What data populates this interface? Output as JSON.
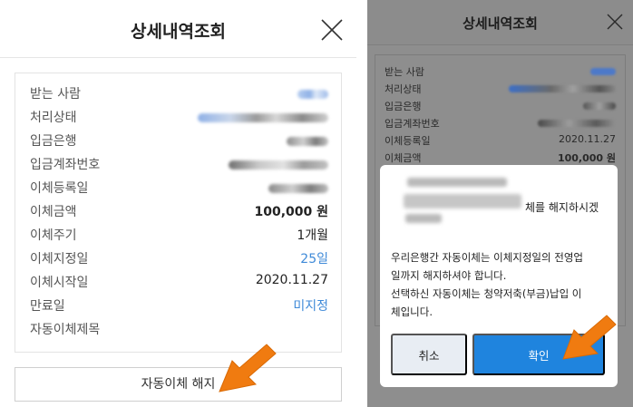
{
  "left": {
    "title": "상세내역조회",
    "rows": [
      {
        "label": "받는 사람",
        "value": ""
      },
      {
        "label": "처리상태",
        "value": ""
      },
      {
        "label": "입금은행",
        "value": ""
      },
      {
        "label": "입금계좌번호",
        "value": ""
      },
      {
        "label": "이체등록일",
        "value": ""
      },
      {
        "label": "이체금액",
        "value": "100,000 원"
      },
      {
        "label": "이체주기",
        "value": "1개월"
      },
      {
        "label": "이체지정일",
        "value": "25일"
      },
      {
        "label": "이체시작일",
        "value": "2020.11.27"
      },
      {
        "label": "만료일",
        "value": "미지정"
      },
      {
        "label": "자동이체제목",
        "value": ""
      }
    ],
    "cancel_auto_button": "자동이체 해지"
  },
  "right": {
    "title": "상세내역조회",
    "rows": [
      {
        "label": "받는 사람",
        "value": ""
      },
      {
        "label": "처리상태",
        "value": ""
      },
      {
        "label": "입금은행",
        "value": ""
      },
      {
        "label": "입금계좌번호",
        "value": ""
      },
      {
        "label": "이체등록일",
        "value": "2020.11.27"
      },
      {
        "label": "이체금액",
        "value": "100,000 원"
      }
    ],
    "dialog": {
      "title_suffix": "체를 해지하시겠",
      "body_line1": "우리은행간 자동이체는 이체지정일의 전영업",
      "body_line2": "일까지 해지하셔야 합니다.",
      "body_line3": "선택하신 자동이체는 청약저축(부금)납입 이",
      "body_line4": "체입니다.",
      "cancel_label": "취소",
      "ok_label": "확인"
    }
  },
  "colors": {
    "accent_blue": "#3f8ad8",
    "ok_button": "#1f84de",
    "arrow_orange": "#f07b10"
  },
  "icons": [
    "close-icon",
    "arrow-pointer-icon"
  ]
}
